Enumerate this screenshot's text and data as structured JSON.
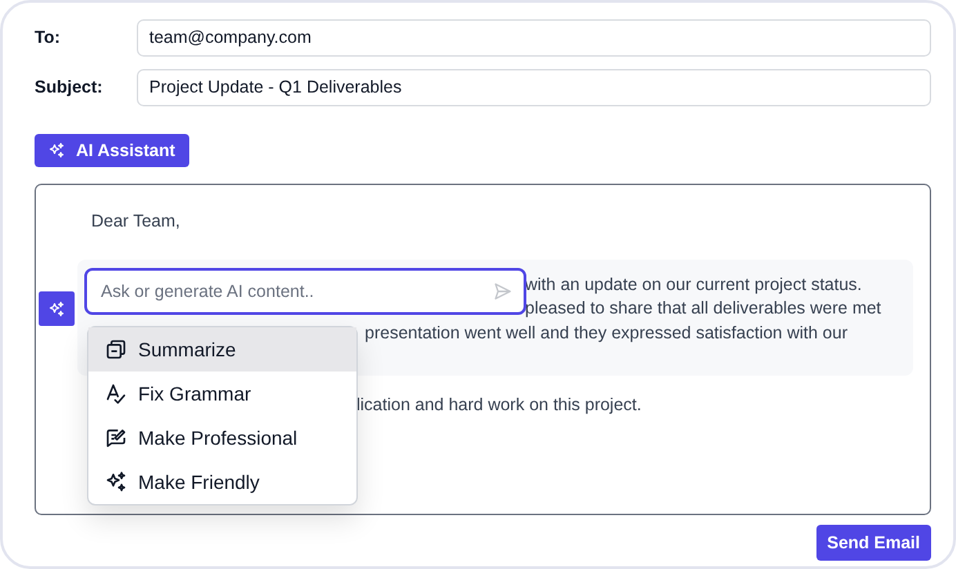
{
  "fields": [
    {
      "label": "To:",
      "value": "team@company.com"
    },
    {
      "label": "Subject:",
      "value": "Project Update - Q1 Deliverables"
    }
  ],
  "ai_assistant_button": "AI Assistant",
  "editor": {
    "greeting": "Dear Team,",
    "paragraph_lines": [
      {
        "text": "with an update on our current project status."
      },
      {
        "text": "pleased to share that all deliverables were met"
      },
      {
        "text": "presentation went well and they expressed satisfaction with our"
      }
    ],
    "closing_line": "lication and hard work on this project."
  },
  "ai_popup": {
    "placeholder": "Ask or generate AI content..",
    "menu": [
      {
        "label": "Summarize",
        "selected": true
      },
      {
        "label": "Fix Grammar",
        "selected": false
      },
      {
        "label": "Make Professional",
        "selected": false
      },
      {
        "label": "Make Friendly",
        "selected": false
      }
    ]
  },
  "send_button": "Send Email"
}
